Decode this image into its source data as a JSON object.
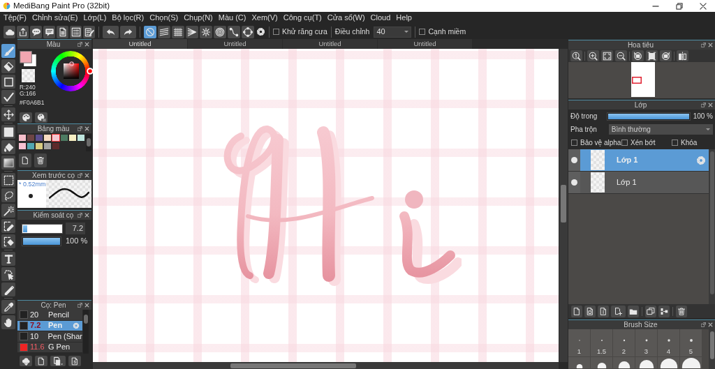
{
  "window": {
    "title": "MediBang Paint Pro (32bit)"
  },
  "menu": [
    "Tệp(F)",
    "Chỉnh sửa(E)",
    "Lớp(L)",
    "Bộ lọc(R)",
    "Chọn(S)",
    "Chụp(N)",
    "Màu (C)",
    "Xem(V)",
    "Công cụ(T)",
    "Cửa sổ(W)",
    "Cloud",
    "Help"
  ],
  "toolbar": {
    "snaps": [
      {
        "kind": "nosnap",
        "selected": true
      },
      {
        "kind": "parallel",
        "selected": false
      },
      {
        "kind": "grid",
        "selected": false
      },
      {
        "kind": "perspective",
        "selected": false
      },
      {
        "kind": "radial",
        "selected": false
      },
      {
        "kind": "concentric",
        "selected": false
      },
      {
        "kind": "curve",
        "selected": false
      },
      {
        "kind": "circle",
        "selected": false
      }
    ],
    "antialias": {
      "label": "Khử răng cưa",
      "checked": false
    },
    "correction": {
      "label": "Điều chỉnh",
      "value": "40"
    },
    "soft_edge": {
      "label": "Cạnh miềm",
      "checked": false
    }
  },
  "tools": [
    {
      "kind": "brush",
      "selected": true
    },
    {
      "kind": "eraser",
      "selected": false
    },
    {
      "kind": "shape",
      "selected": false
    },
    {
      "kind": "dot",
      "selected": false
    },
    {
      "kind": "move",
      "selected": false
    },
    {
      "kind": "fill",
      "selected": false
    },
    {
      "kind": "bucket",
      "selected": false
    },
    {
      "kind": "gradient",
      "selected": false
    },
    {
      "kind": "select",
      "selected": false
    },
    {
      "kind": "lasso",
      "selected": false
    },
    {
      "kind": "wand",
      "selected": false
    },
    {
      "kind": "selectpen",
      "selected": false
    },
    {
      "kind": "selecteraser",
      "selected": false
    },
    {
      "kind": "text",
      "selected": false
    },
    {
      "kind": "operation",
      "selected": false
    },
    {
      "kind": "divide",
      "selected": false
    },
    {
      "kind": "eyedropper",
      "selected": false
    },
    {
      "kind": "hand",
      "selected": false
    }
  ],
  "color_panel": {
    "title": "Màu",
    "primary": {
      "color": "#f0a6b1"
    },
    "secondary": {
      "color": "#ffffff"
    },
    "readouts": [
      "R:240",
      "G:166",
      "#F0A6B1"
    ]
  },
  "palette_panel": {
    "title": "Bảng màu",
    "swatches": [
      {
        "color": "#f7bfcb",
        "selected": false
      },
      {
        "color": "#6e4545",
        "selected": false
      },
      {
        "color": "#5b4e8e",
        "selected": false
      },
      {
        "color": "#f9dcc2",
        "selected": false
      },
      {
        "color": "#f7c6cf",
        "selected": true
      },
      {
        "color": "#4d7b62",
        "selected": false
      },
      {
        "color": "#f7efc3",
        "selected": false
      },
      {
        "color": "#bfe6de",
        "selected": false
      },
      {
        "color": "#f8c2d2",
        "selected": false
      },
      {
        "color": "#52a7b1",
        "selected": false
      },
      {
        "color": "#d9cc82",
        "selected": false
      },
      {
        "color": "#a2a2a2",
        "selected": false
      },
      {
        "color": "#5e2a2a",
        "selected": false
      }
    ]
  },
  "brush_preview": {
    "title": "Xem trước cọ",
    "size": "* 0.52mm"
  },
  "brush_control": {
    "title": "Kiểm soát cọ",
    "size": {
      "level": 0.1,
      "value": "7.2"
    },
    "opacity": {
      "level": 1,
      "value": "100 %"
    }
  },
  "brush_list": {
    "title": "Cọ: Pen",
    "items": [
      {
        "size": "20",
        "name": "Pencil",
        "color": "#222222",
        "selected": false,
        "size_highlighted": false
      },
      {
        "size": "7.2",
        "name": "Pen",
        "color": "#222222",
        "selected": true,
        "size_highlighted": true
      },
      {
        "size": "10",
        "name": "Pen (Shar",
        "color": "#222222",
        "selected": false,
        "size_highlighted": false
      },
      {
        "size": "11.6",
        "name": "G Pen",
        "color": "#ee2424",
        "selected": false,
        "size_highlighted": true
      }
    ]
  },
  "tabs": [
    {
      "label": "Untitled",
      "selected": true
    },
    {
      "label": "Untitled",
      "selected": false
    },
    {
      "label": "Untitled",
      "selected": false
    },
    {
      "label": "Untitled",
      "selected": false
    }
  ],
  "navigator": {
    "title": "Hoa tiêu"
  },
  "layers": {
    "title": "Lớp",
    "opacity": {
      "label": "Độ trong",
      "level": 1,
      "value": "100 %"
    },
    "blend": {
      "label": "Pha trộn",
      "value": "Bình thường"
    },
    "options": [
      {
        "label": "Bảo vệ alpha",
        "checked": false
      },
      {
        "label": "Xén bớt",
        "checked": false
      },
      {
        "label": "Khóa",
        "checked": false
      }
    ],
    "items": [
      {
        "name": "Lớp 1",
        "selected": true,
        "visible": true
      },
      {
        "name": "Lớp 1",
        "selected": false,
        "visible": true
      }
    ]
  },
  "brush_size": {
    "title": "Brush Size",
    "presets": [
      "1",
      "1.5",
      "2",
      "3",
      "4",
      "5"
    ]
  }
}
